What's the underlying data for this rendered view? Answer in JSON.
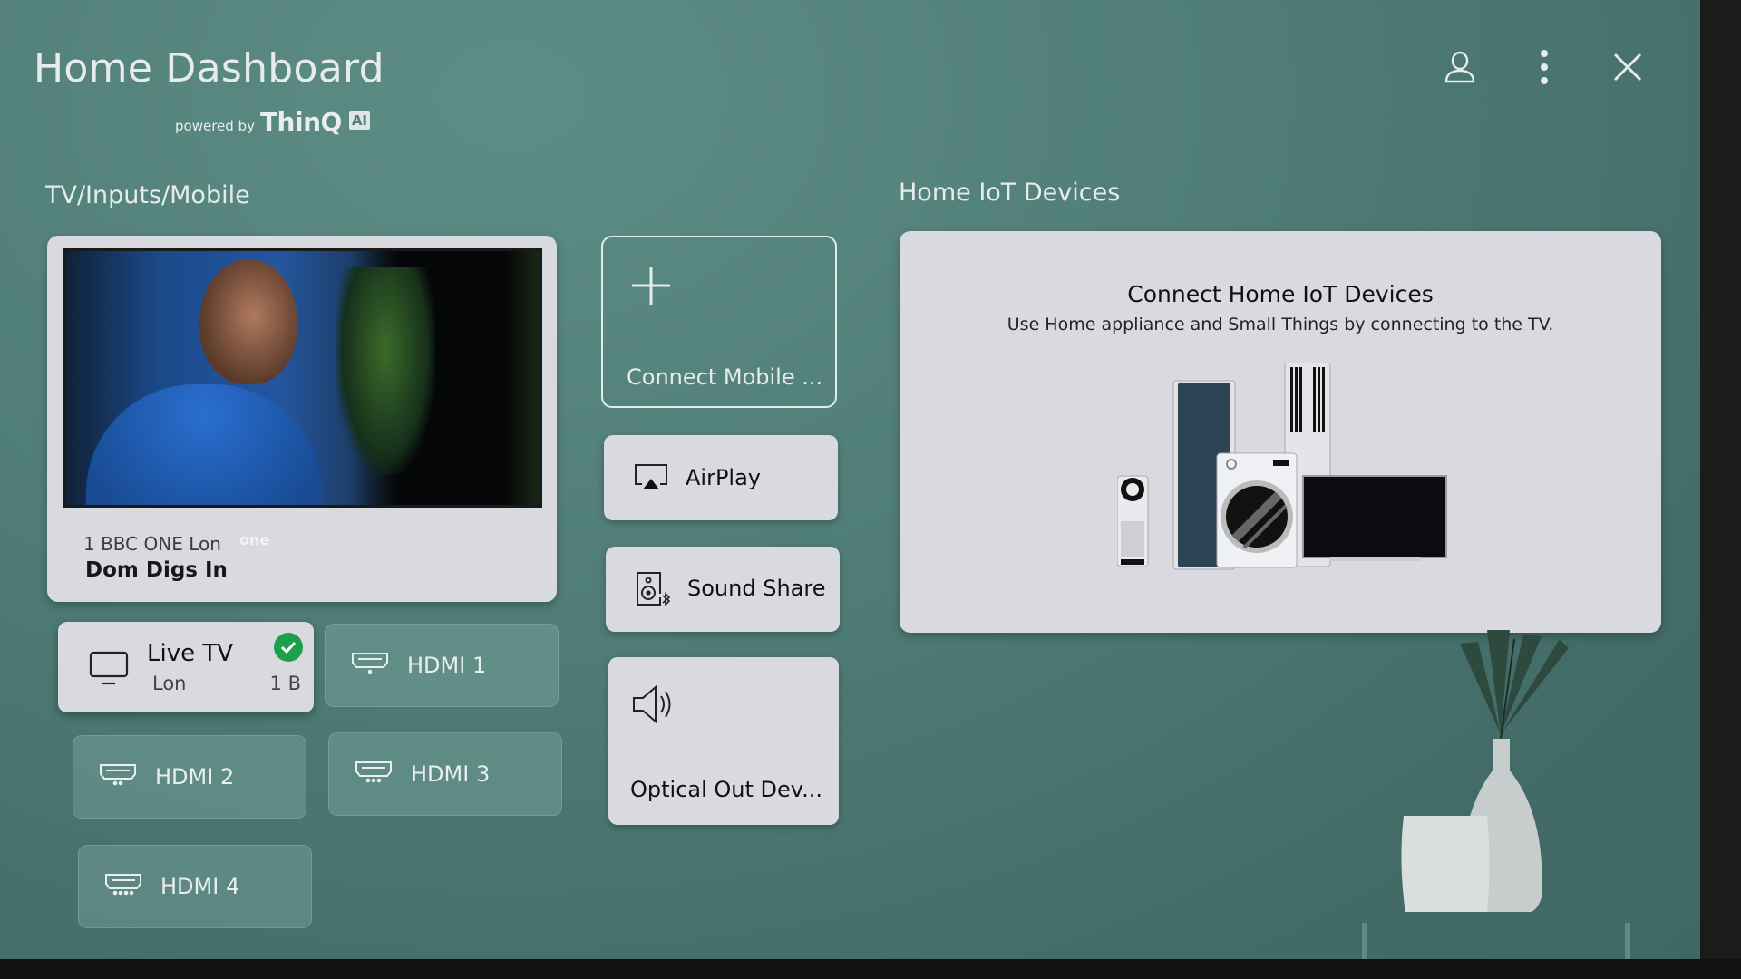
{
  "header": {
    "title": "Home Dashboard",
    "powered_by_prefix": "powered by",
    "powered_by_brand": "ThinQ",
    "powered_by_badge": "AI",
    "icons": [
      "profile-icon",
      "more-options-icon",
      "close-icon"
    ]
  },
  "tv_section": {
    "label": "TV/Inputs/Mobile",
    "now_playing": {
      "channel": "1 BBC ONE Lon",
      "channel_logo": "one",
      "program": "Dom Digs In"
    },
    "inputs": [
      {
        "id": "live-tv",
        "label": "Live TV",
        "sub": "Lon",
        "channel_num": "1 B",
        "selected": true,
        "icon": "tv-icon"
      },
      {
        "id": "hdmi-1",
        "label": "HDMI 1",
        "icon": "hdmi-icon"
      },
      {
        "id": "hdmi-2",
        "label": "HDMI 2",
        "icon": "hdmi-icon"
      },
      {
        "id": "hdmi-3",
        "label": "HDMI 3",
        "icon": "hdmi-icon"
      },
      {
        "id": "hdmi-4",
        "label": "HDMI 4",
        "icon": "hdmi-icon"
      }
    ],
    "mobile": [
      {
        "id": "connect-mobile",
        "label": "Connect Mobile ...",
        "icon": "plus-icon"
      },
      {
        "id": "airplay",
        "label": "AirPlay",
        "icon": "airplay-icon"
      },
      {
        "id": "sound-share",
        "label": "Sound Share",
        "icon": "bluetooth-speaker-icon"
      },
      {
        "id": "optical-out",
        "label": "Optical Out Dev...",
        "icon": "speaker-icon"
      }
    ]
  },
  "iot_section": {
    "label": "Home IoT Devices",
    "card_title": "Connect Home IoT Devices",
    "card_desc": "Use Home appliance and Small Things by connecting to the TV."
  },
  "colors": {
    "background": "#4f7c76",
    "card": "#d9dae0",
    "check": "#1ea04a"
  }
}
